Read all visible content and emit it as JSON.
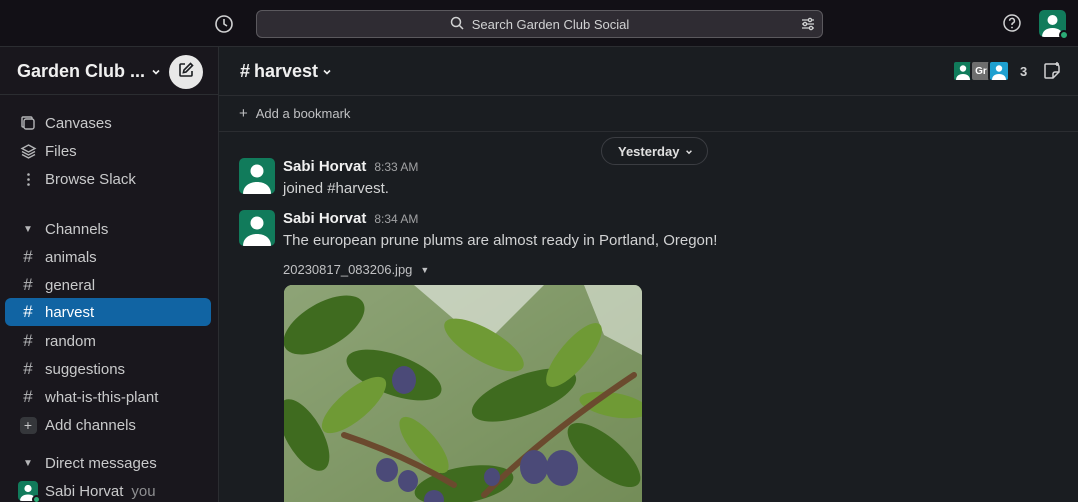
{
  "search": {
    "placeholder": "Search Garden Club Social"
  },
  "workspace": {
    "name": "Garden Club ..."
  },
  "sidebar": {
    "nav": [
      {
        "label": "Canvases",
        "icon": "canvas-icon"
      },
      {
        "label": "Files",
        "icon": "layers-icon"
      },
      {
        "label": "Browse Slack",
        "icon": "more-vertical-icon"
      }
    ],
    "channels_title": "Channels",
    "channels": [
      "animals",
      "general",
      "harvest",
      "random",
      "suggestions",
      "what-is-this-plant"
    ],
    "active_channel": "harvest",
    "add_channels": "Add channels",
    "dms_title": "Direct messages",
    "dm_user": "Sabi Horvat",
    "dm_you": "you"
  },
  "channel": {
    "name": "harvest",
    "member_count": "3",
    "member_initials": "Gr",
    "add_bookmark": "Add a bookmark"
  },
  "date_divider": "Yesterday",
  "messages": [
    {
      "author": "Sabi Horvat",
      "time": "8:33 AM",
      "text": "joined #harvest."
    },
    {
      "author": "Sabi Horvat",
      "time": "8:34 AM",
      "text": "The european prune plums are almost ready in Portland, Oregon!",
      "file": "20230817_083206.jpg"
    }
  ],
  "colors": {
    "accent": "#1164a3",
    "avatar": "#117b5b",
    "presence": "#2bac76",
    "background": "#1a1d21"
  }
}
